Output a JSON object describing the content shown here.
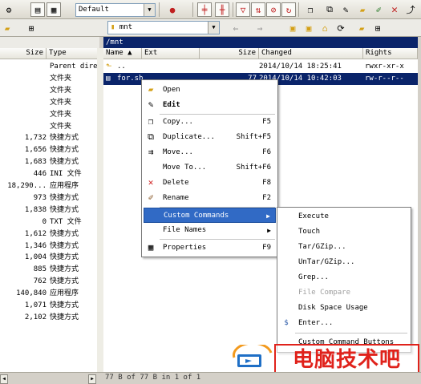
{
  "toolbar": {
    "layout_combo": "Default",
    "icons": [
      "gear-icon",
      "save-icon",
      "layout-icon",
      "palette-icon",
      "grid-icon",
      "filter-icons",
      "copy-icons",
      "edit-icon",
      "folder-icon",
      "pen-icon",
      "delete-icon",
      "up-icon"
    ]
  },
  "address": {
    "path_value": "mnt"
  },
  "right_pane": {
    "path": "/mnt",
    "columns": {
      "name": "Name",
      "ext": "Ext",
      "size": "Size",
      "changed": "Changed",
      "rights": "Rights"
    },
    "rows": [
      {
        "name": "..",
        "ext": "",
        "size": "",
        "changed": "2014/10/14 18:25:41",
        "rights": "rwxr-xr-x"
      },
      {
        "name": "for.sh",
        "ext": "",
        "size": "77",
        "changed": "2014/10/14 10:42:03",
        "rights": "rw-r--r--"
      }
    ]
  },
  "left_pane": {
    "columns": {
      "size": "Size",
      "type": "Type"
    },
    "rows": [
      {
        "size": "",
        "type": "Parent dire"
      },
      {
        "size": "",
        "type": "文件夹"
      },
      {
        "size": "",
        "type": "文件夹"
      },
      {
        "size": "",
        "type": "文件夹"
      },
      {
        "size": "",
        "type": "文件夹"
      },
      {
        "size": "",
        "type": "文件夹"
      },
      {
        "size": "1,732",
        "type": "快捷方式"
      },
      {
        "size": "1,656",
        "type": "快捷方式"
      },
      {
        "size": "1,683",
        "type": "快捷方式"
      },
      {
        "size": "446",
        "type": "INI 文件"
      },
      {
        "size": "18,290...",
        "type": "应用程序"
      },
      {
        "size": "973",
        "type": "快捷方式"
      },
      {
        "size": "1,838",
        "type": "快捷方式"
      },
      {
        "size": "0",
        "type": "TXT 文件"
      },
      {
        "size": "1,612",
        "type": "快捷方式"
      },
      {
        "size": "1,346",
        "type": "快捷方式"
      },
      {
        "size": "1,004",
        "type": "快捷方式"
      },
      {
        "size": "885",
        "type": "快捷方式"
      },
      {
        "size": "762",
        "type": "快捷方式"
      },
      {
        "size": "140,840",
        "type": "应用程序"
      },
      {
        "size": "1,071",
        "type": "快捷方式"
      },
      {
        "size": "2,102",
        "type": "快捷方式"
      }
    ]
  },
  "context_menu": {
    "items": [
      {
        "label": "Open",
        "shortcut": ""
      },
      {
        "label": "Edit",
        "shortcut": ""
      },
      {
        "label": "Copy...",
        "shortcut": "F5"
      },
      {
        "label": "Duplicate...",
        "shortcut": "Shift+F5"
      },
      {
        "label": "Move...",
        "shortcut": "F6"
      },
      {
        "label": "Move To...",
        "shortcut": "Shift+F6"
      },
      {
        "label": "Delete",
        "shortcut": "F8"
      },
      {
        "label": "Rename",
        "shortcut": "F2"
      },
      {
        "label": "Custom Commands",
        "shortcut": ""
      },
      {
        "label": "File Names",
        "shortcut": ""
      },
      {
        "label": "Properties",
        "shortcut": "F9"
      }
    ]
  },
  "submenu": {
    "items": [
      {
        "label": "Execute"
      },
      {
        "label": "Touch"
      },
      {
        "label": "Tar/GZip..."
      },
      {
        "label": "UnTar/GZip..."
      },
      {
        "label": "Grep..."
      },
      {
        "label": "File Compare"
      },
      {
        "label": "Disk Space Usage"
      },
      {
        "label": "Enter..."
      },
      {
        "label": "Custom Command Buttons"
      }
    ]
  },
  "status": {
    "text": "77 B of 77 B in 1 of 1"
  },
  "watermark": {
    "text": "电脑技术吧"
  },
  "colors": {
    "menu_highlight": "#316ac5",
    "watermark_red": "#e0221b",
    "watermark_orange": "#f39a1e"
  }
}
